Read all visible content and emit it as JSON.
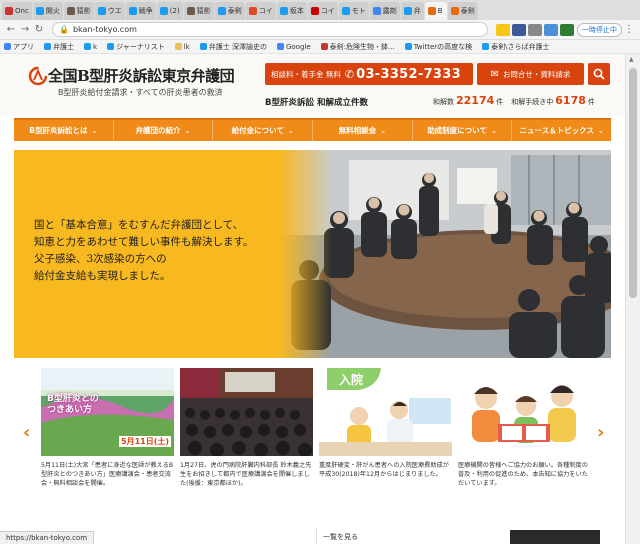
{
  "tabs": [
    {
      "label": "Onc",
      "color": "#cc3333",
      "active": false
    },
    {
      "label": "開火",
      "color": "#1d9bf0",
      "active": false
    },
    {
      "label": "猿影",
      "color": "#6d5a4a",
      "active": false
    },
    {
      "label": "ウエ",
      "color": "#1d9bf0",
      "active": false
    },
    {
      "label": "戦争",
      "color": "#1d9bf0",
      "active": false
    },
    {
      "label": "(2)",
      "color": "#1d9bf0",
      "active": false
    },
    {
      "label": "猿影",
      "color": "#6d5a4a",
      "active": false
    },
    {
      "label": "泰剣",
      "color": "#1d9bf0",
      "active": false
    },
    {
      "label": "コイ",
      "color": "#e04a2b",
      "active": false
    },
    {
      "label": "坂本",
      "color": "#1d9bf0",
      "active": false
    },
    {
      "label": "コイ",
      "color": "#c00",
      "active": false
    },
    {
      "label": "モト",
      "color": "#1d9bf0",
      "active": false
    },
    {
      "label": "露剤",
      "color": "#4285f4",
      "active": false
    },
    {
      "label": "弁",
      "color": "#1d9bf0",
      "active": false
    },
    {
      "label": "B",
      "color": "#e86a10",
      "active": true
    },
    {
      "label": "泰剣",
      "color": "#e86a10",
      "active": false
    }
  ],
  "toolbar": {
    "url": "bkan-tokyo.com",
    "pause_label": "一時停止中"
  },
  "bookmarks": [
    {
      "label": "アプリ",
      "color": "#4285f4"
    },
    {
      "label": "弁護士",
      "color": "#1d9bf0"
    },
    {
      "label": "k",
      "color": "#1d9bf0"
    },
    {
      "label": "ジャーナリスト",
      "color": "#1d9bf0"
    },
    {
      "label": "lk",
      "color": "#e6c35c"
    },
    {
      "label": "弁護士 深澤諭史の",
      "color": "#1d9bf0"
    },
    {
      "label": "Google",
      "color": "#4285f4"
    },
    {
      "label": "泰剣:危険生物・鉢...",
      "color": "#cc3333"
    },
    {
      "label": "Twitterの高度な検",
      "color": "#1d9bf0"
    },
    {
      "label": "泰剣\\さらば弁護士",
      "color": "#1d9bf0"
    }
  ],
  "header": {
    "title": "全国B型肝炎訴訟東京弁護団",
    "subtitle": "B型肝炎給付金請求・すべての肝炎患者の救済",
    "consult_label": "相談料・着手金 無料",
    "phone": "03-3352-7333",
    "inquiry_label": "お問合せ・資料請求",
    "stats_title": "B型肝炎訴訟 和解成立件数",
    "settled_label": "和解数",
    "settled_count": "22174",
    "settled_unit": "件",
    "pending_label": "和解手続き中",
    "pending_count": "6178",
    "pending_unit": "件"
  },
  "nav": [
    "B型肝炎訴訟とは",
    "弁護団の紹介",
    "給付金について",
    "無料相談会",
    "助成制度について",
    "ニュース＆トピックス"
  ],
  "hero": {
    "lines": [
      "国と「基本合意」をむすんだ弁護団として、",
      "知恵と力をあわせて難しい事件も解決します。",
      "父子感染、3次感染の方への",
      "給付金支給も実現しました。"
    ]
  },
  "cards": [
    {
      "thumb_title": "B型肝炎との\nつきあい方",
      "thumb_date": "5月11日(土)",
      "caption": "5月11日(土)大宮「患者に身近な医師が教えるB型肝炎とのつきあい方」医療講演会・患者交流会・無料相談会を開催。"
    },
    {
      "caption": "1月27日、虎の門病院肝臓内科部長 鈴木義之先生をお招きして都内で医療講演会を開催しました(後援：東京都ほか)。"
    },
    {
      "thumb_title": "入院",
      "caption": "重度肝硬変・肝がん患者への入院医療費助成が平成30(2018)年12月からはじまりました。"
    },
    {
      "caption": "医療機関の皆様へご協力のお願い。各種制度の普及・利用の促進のため、本告知に協力をいただいています。"
    }
  ],
  "bottom": {
    "see_list": "一覧を見る",
    "status_url": "https://bkan-tokyo.com"
  },
  "colors": {
    "brand_orange": "#f08a18",
    "accent_red": "#d8430e",
    "hero_yellow": "#f8b81f"
  }
}
